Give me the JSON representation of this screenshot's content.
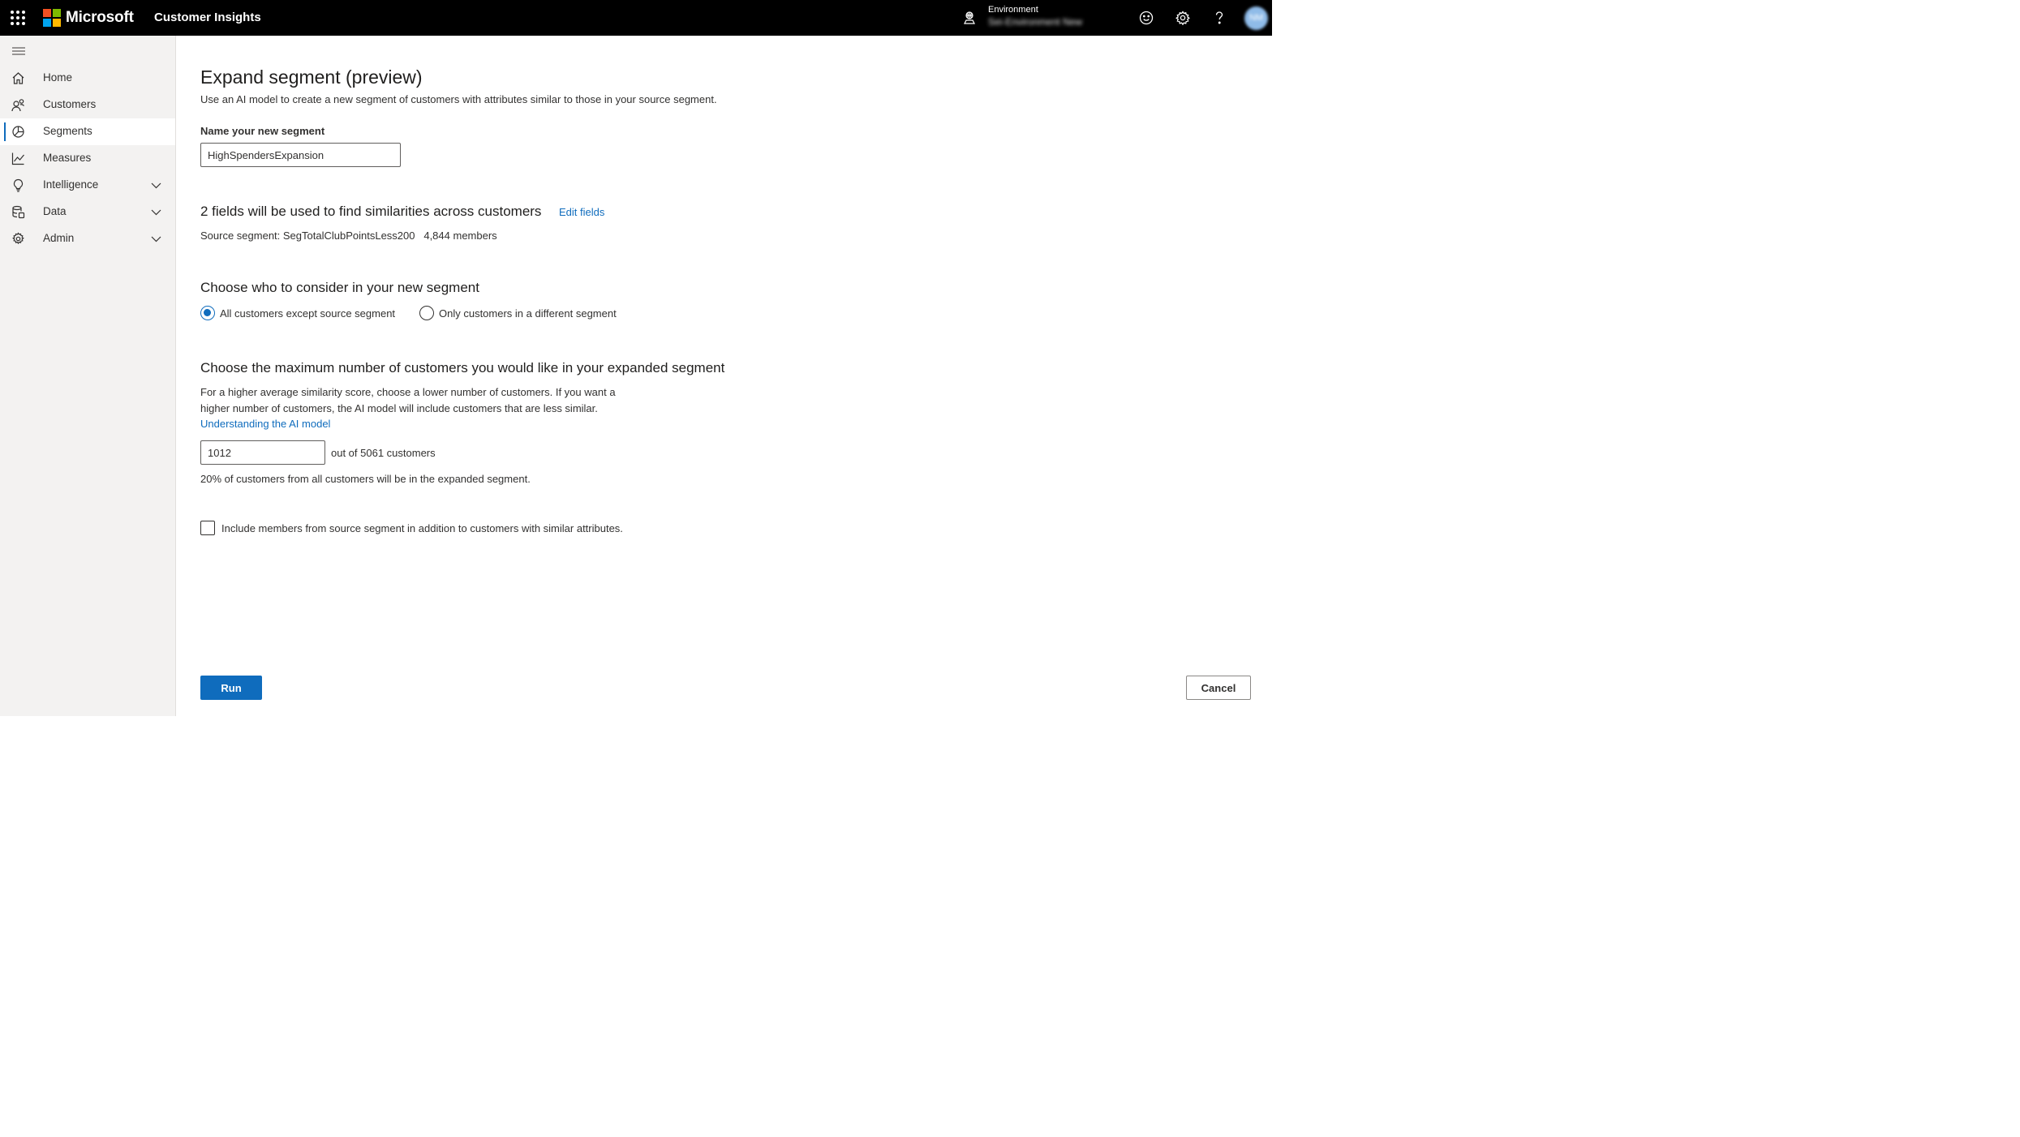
{
  "header": {
    "brand": "Microsoft",
    "app_name": "Customer Insights",
    "environment_label": "Environment",
    "environment_value": "Sei-Environment New",
    "avatar_initials": "NM",
    "icons": [
      "waffle-icon",
      "environment-icon",
      "feedback-smiley-icon",
      "settings-gear-icon",
      "help-question-icon"
    ]
  },
  "sidebar": {
    "items": [
      {
        "label": "Home",
        "icon": "home-icon",
        "selected": false,
        "expandable": false
      },
      {
        "label": "Customers",
        "icon": "customers-icon",
        "selected": false,
        "expandable": false
      },
      {
        "label": "Segments",
        "icon": "segments-icon",
        "selected": true,
        "expandable": false
      },
      {
        "label": "Measures",
        "icon": "measures-icon",
        "selected": false,
        "expandable": false
      },
      {
        "label": "Intelligence",
        "icon": "lightbulb-icon",
        "selected": false,
        "expandable": true
      },
      {
        "label": "Data",
        "icon": "data-icon",
        "selected": false,
        "expandable": true
      },
      {
        "label": "Admin",
        "icon": "admin-gear-icon",
        "selected": false,
        "expandable": true
      }
    ]
  },
  "main": {
    "title": "Expand segment (preview)",
    "subtitle": "Use an AI model to create a new segment of customers with attributes similar to those in your source segment.",
    "name_label": "Name your new segment",
    "name_value": "HighSpendersExpansion",
    "fields_heading": "2 fields will be used to find similarities across customers",
    "edit_fields_link": "Edit fields",
    "source_segment": "Source segment: SegTotalClubPointsLess200",
    "source_members": "4,844 members",
    "consider_heading": "Choose who to consider in your new segment",
    "radio_all": "All customers except source segment",
    "radio_only": "Only customers in a different segment",
    "selected_radio": "all",
    "max_heading": "Choose the maximum number of customers you would like in your expanded segment",
    "max_desc": "For a higher average similarity score, choose a lower number of customers. If you want a higher number of customers, the AI model will include customers that are less similar.",
    "understanding_link": "Understanding the AI model",
    "max_value": "1012",
    "out_of_text": "out of 5061 customers",
    "percent_text": "20% of customers from all customers will be in the expanded segment.",
    "include_checkbox_label": "Include members from source segment in addition to customers with similar attributes.",
    "include_checked": false,
    "run_label": "Run",
    "cancel_label": "Cancel"
  },
  "colors": {
    "topbar": "#000000",
    "accent": "#0f6cbd",
    "sidebar_bg": "#f3f2f1",
    "ms_red": "#f25022",
    "ms_green": "#7fba00",
    "ms_blue": "#00a4ef",
    "ms_yellow": "#ffb900"
  }
}
